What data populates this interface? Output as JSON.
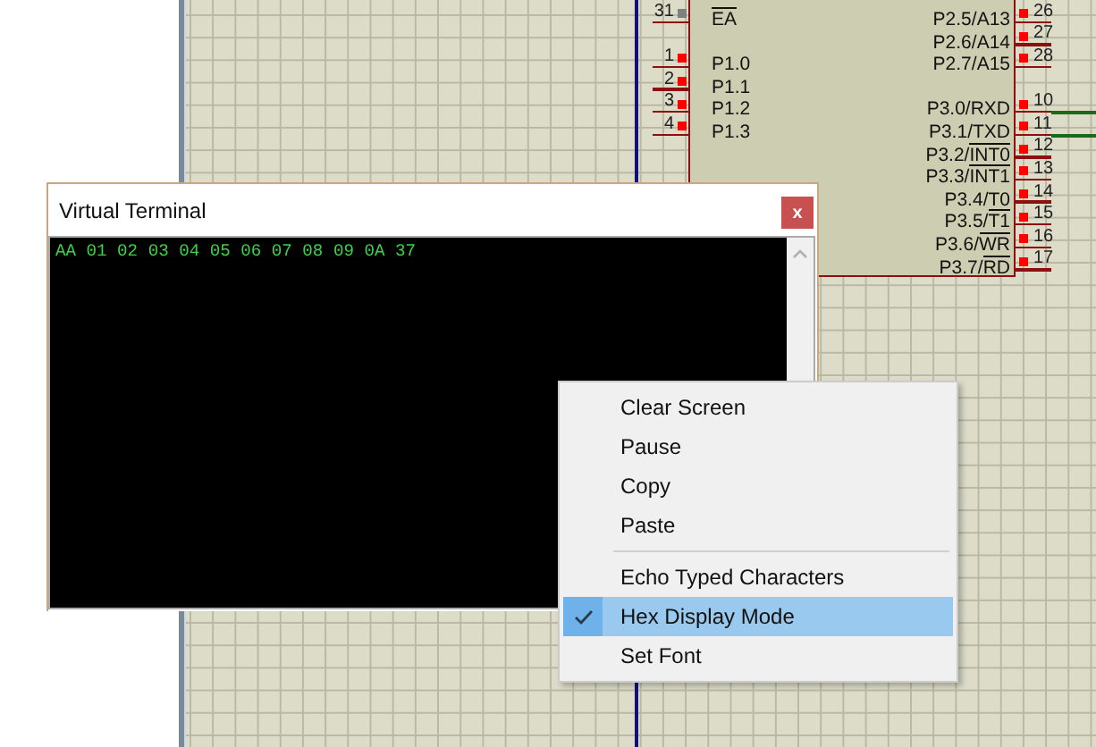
{
  "chip": {
    "left_groups": [
      [
        {
          "number": "31",
          "overlined": "EA",
          "color": "#808080"
        }
      ],
      [
        {
          "number": "1",
          "label": "P1.0",
          "color": "#ff0000"
        },
        {
          "number": "2",
          "label": "P1.1",
          "color": "#ff0000"
        },
        {
          "number": "3",
          "label": "P1.2",
          "color": "#ff0000"
        },
        {
          "number": "4",
          "label": "P1.3",
          "color": "#ff0000"
        }
      ]
    ],
    "right_groups": [
      [
        {
          "number": "26",
          "label": "P2.5/A13",
          "color": "#ff0000"
        },
        {
          "number": "27",
          "label": "P2.6/A14",
          "color": "#ff0000"
        },
        {
          "number": "28",
          "label": "P2.7/A15",
          "color": "#ff0000"
        }
      ],
      [
        {
          "number": "10",
          "label": "P3.0/RXD",
          "color": "#ff0000",
          "connected": true
        },
        {
          "number": "11",
          "label": "P3.1/TXD",
          "color": "#ff0000",
          "connected": true
        },
        {
          "number": "12",
          "label": "P3.2/",
          "overlined": "INT0",
          "color": "#ff0000"
        },
        {
          "number": "13",
          "label": "P3.3/",
          "overlined": "INT1",
          "color": "#ff0000"
        },
        {
          "number": "14",
          "label": "P3.4/T0",
          "color": "#ff0000"
        },
        {
          "number": "15",
          "label": "P3.5/",
          "overlined": "T1",
          "color": "#ff0000"
        },
        {
          "number": "16",
          "label": "P3.6/",
          "overlined": "WR",
          "color": "#ff0000"
        },
        {
          "number": "17",
          "label": "P3.7/",
          "overlined": "RD",
          "color": "#ff0000"
        }
      ]
    ]
  },
  "terminal": {
    "title": "Virtual Terminal",
    "close": "x",
    "lines": [
      "AA 01 02 03 04 05 06 07 08 09 0A 37"
    ]
  },
  "context_menu": [
    {
      "kind": "item",
      "label": "Clear Screen",
      "checked": false,
      "selected": false
    },
    {
      "kind": "item",
      "label": "Pause",
      "checked": false,
      "selected": false
    },
    {
      "kind": "item",
      "label": "Copy",
      "checked": false,
      "selected": false
    },
    {
      "kind": "item",
      "label": "Paste",
      "checked": false,
      "selected": false
    },
    {
      "kind": "separator"
    },
    {
      "kind": "item",
      "label": "Echo Typed Characters",
      "checked": false,
      "selected": false
    },
    {
      "kind": "item",
      "label": "Hex Display Mode",
      "checked": true,
      "selected": true
    },
    {
      "kind": "item",
      "label": "Set Font",
      "checked": false,
      "selected": false
    }
  ]
}
